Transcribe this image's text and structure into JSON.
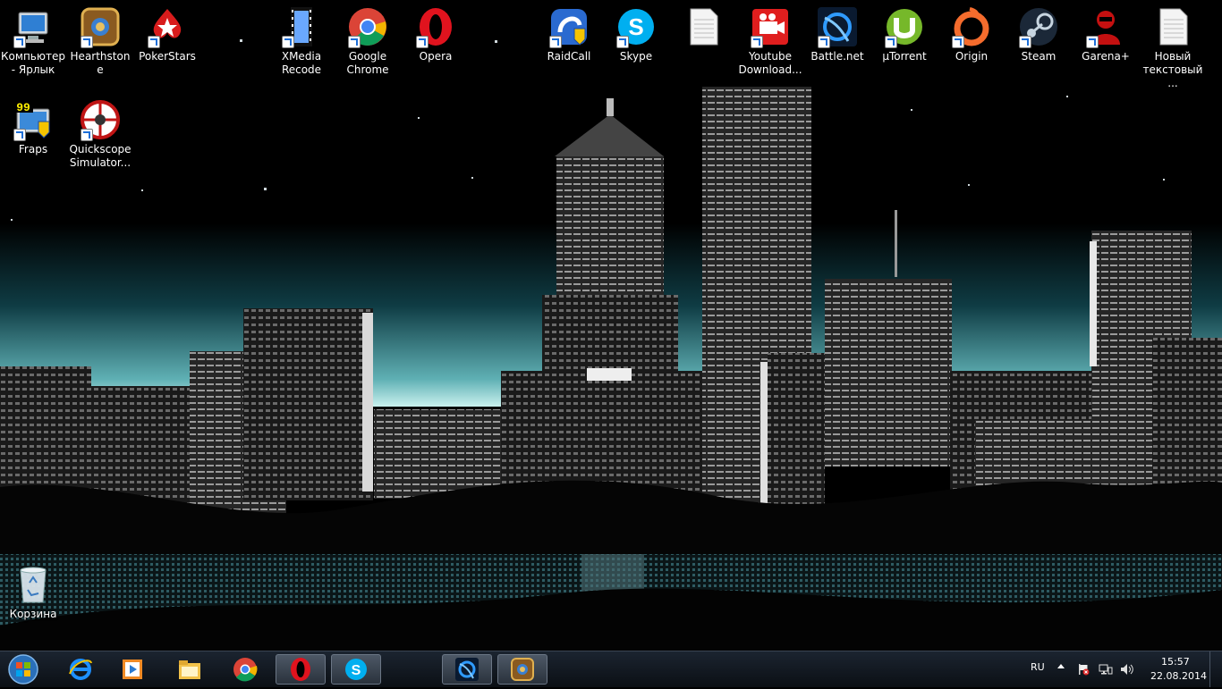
{
  "desktop": {
    "icons": [
      {
        "label": "Компьютер - Ярлык",
        "icon": "computer-icon"
      },
      {
        "label": "Hearthstone",
        "icon": "hearthstone-icon"
      },
      {
        "label": "PokerStars",
        "icon": "pokerstars-icon"
      },
      {
        "label": "XMedia Recode",
        "icon": "xmedia-recode-icon"
      },
      {
        "label": "Google Chrome",
        "icon": "chrome-icon"
      },
      {
        "label": "Opera",
        "icon": "opera-icon"
      },
      {
        "label": "RaidCall",
        "icon": "raidcall-icon"
      },
      {
        "label": "Skype",
        "icon": "skype-icon"
      },
      {
        "label": "",
        "icon": "text-file-icon"
      },
      {
        "label": "Youtube Download...",
        "icon": "youtube-downloader-icon"
      },
      {
        "label": "Battle.net",
        "icon": "battlenet-icon"
      },
      {
        "label": "µTorrent",
        "icon": "utorrent-icon"
      },
      {
        "label": "Origin",
        "icon": "origin-icon"
      },
      {
        "label": "Steam",
        "icon": "steam-icon"
      },
      {
        "label": "Garena+",
        "icon": "garena-icon"
      },
      {
        "label": "Новый текстовый ...",
        "icon": "text-file-icon"
      },
      {
        "label": "Fraps",
        "icon": "fraps-icon"
      },
      {
        "label": "Quickscope Simulator...",
        "icon": "quickscope-icon"
      },
      {
        "label": "Корзина",
        "icon": "recycle-bin-icon"
      }
    ],
    "fraps_counter": "99"
  },
  "taskbar": {
    "pinned": [
      "internet-explorer-icon",
      "media-player-icon",
      "explorer-icon",
      "chrome-icon",
      "opera-icon",
      "skype-icon",
      "battlenet-icon",
      "hearthstone-icon"
    ],
    "language": "RU",
    "time": "15:57",
    "date": "22.08.2014"
  },
  "colors": {
    "sky": "#000000",
    "haze": "#8fd3d3",
    "taskbar": "#141b24"
  }
}
